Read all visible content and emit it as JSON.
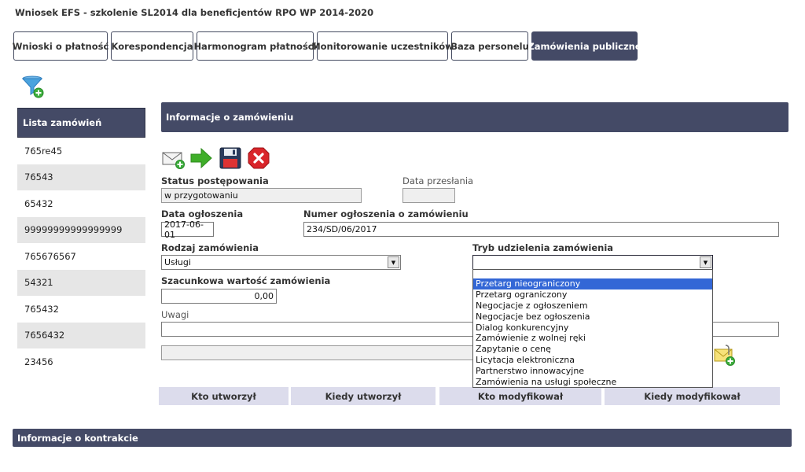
{
  "app_title": "Wniosek EFS - szkolenie SL2014 dla beneficjentów RPO WP 2014-2020",
  "tabs": [
    {
      "label": "Wnioski o płatność",
      "active": false
    },
    {
      "label": "Korespondencja",
      "active": false
    },
    {
      "label": "Harmonogram płatności",
      "active": false
    },
    {
      "label": "Monitorowanie uczestników",
      "active": false
    },
    {
      "label": "Baza personelu",
      "active": false
    },
    {
      "label": "Zamówienia publiczne",
      "active": true
    }
  ],
  "sidebar": {
    "header": "Lista zamówień",
    "items": [
      "765re45",
      "76543",
      "65432",
      "99999999999999999",
      "765676567",
      "54321",
      "765432",
      "7656432",
      "23456"
    ]
  },
  "section": {
    "title": "Informacje o zamówieniu"
  },
  "form": {
    "status_label": "Status postępowania",
    "status_value": "w przygotowaniu",
    "sent_date_label": "Data przesłania",
    "sent_date_value": "",
    "ann_date_label": "Data ogłoszenia",
    "ann_date_value": "2017-06-01",
    "ann_number_label": "Numer ogłoszenia o zamówieniu",
    "ann_number_value": "234/SD/06/2017",
    "kind_label": "Rodzaj zamówienia",
    "kind_value": "Usługi",
    "mode_label": "Tryb udzielenia zamówienia",
    "mode_value": "",
    "est_value_label": "Szacunkowa wartość zamówienia",
    "est_value": "0,00",
    "notes_label": "Uwagi",
    "notes_value": ""
  },
  "mode_options": [
    "Przetarg nieograniczony",
    "Przetarg ograniczony",
    "Negocjacje z ogłoszeniem",
    "Negocjacje bez ogłoszenia",
    "Dialog konkurencyjny",
    "Zamówienie z wolnej ręki",
    "Zapytanie o cenę",
    "Licytacja elektroniczna",
    "Partnerstwo innowacyjne",
    "Zamówienia na usługi społeczne"
  ],
  "mode_highlighted": "Przetarg nieograniczony",
  "columns": [
    "Kto utworzył",
    "Kiedy utworzył",
    "Kto modyfikował",
    "Kiedy modyfikował"
  ],
  "contract_section": {
    "title": "Informacje o kontrakcie"
  },
  "colors": {
    "accent": "#444a66",
    "selection": "#3367d6",
    "delete": "#d9252a",
    "forward": "#3fae29"
  }
}
